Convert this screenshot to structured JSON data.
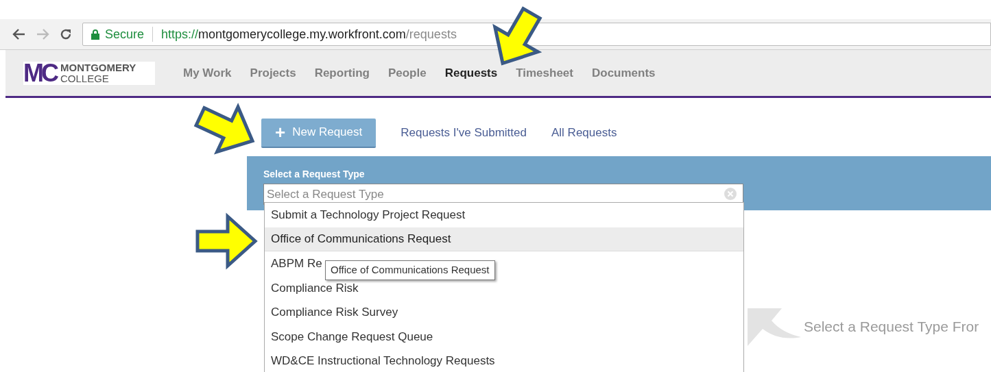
{
  "browser": {
    "secure_label": "Secure",
    "url_scheme": "https://",
    "url_host": "montgomerycollege.my.workfront.com",
    "url_path": "/requests"
  },
  "logo": {
    "mark": "MC",
    "line1": "MONTGOMERY",
    "line2": "COLLEGE"
  },
  "nav": [
    {
      "label": "My Work",
      "selected": false
    },
    {
      "label": "Projects",
      "selected": false
    },
    {
      "label": "Reporting",
      "selected": false
    },
    {
      "label": "People",
      "selected": false
    },
    {
      "label": "Requests",
      "selected": true
    },
    {
      "label": "Timesheet",
      "selected": false
    },
    {
      "label": "Documents",
      "selected": false
    }
  ],
  "new_request_button": {
    "icon": "+",
    "label": "New Request"
  },
  "links": [
    "Requests I've Submitted",
    "All Requests"
  ],
  "panel": {
    "label": "Select a Request Type",
    "placeholder": "Select a Request Type"
  },
  "options": [
    {
      "label": "Submit a Technology Project Request",
      "highlighted": false
    },
    {
      "label": "Office of Communications Request",
      "highlighted": true
    },
    {
      "label": "ABPM Re",
      "highlighted": false
    },
    {
      "label": "Compliance Risk",
      "highlighted": false
    },
    {
      "label": "Compliance Risk Survey",
      "highlighted": false
    },
    {
      "label": "Scope Change Request Queue",
      "highlighted": false
    },
    {
      "label": "WD&CE Instructional Technology Requests",
      "highlighted": false
    }
  ],
  "tooltip": "Office of Communications Request",
  "hint": "Select a Request Type Fror"
}
